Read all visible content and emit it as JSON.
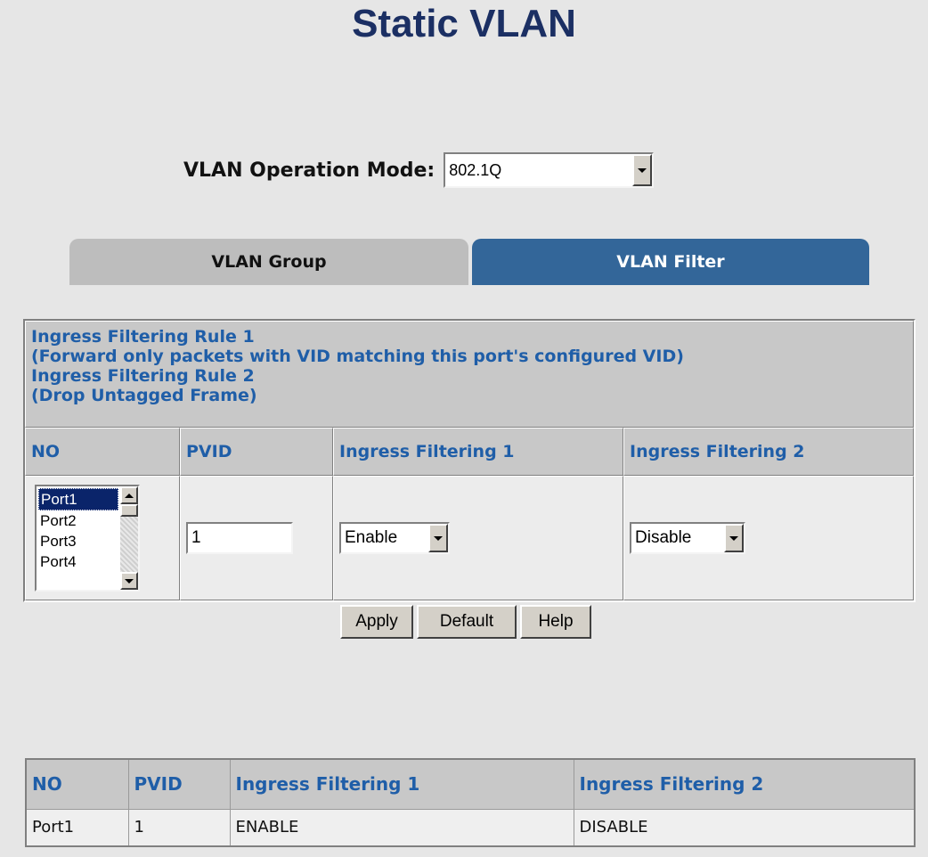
{
  "page": {
    "title": "Static VLAN"
  },
  "mode": {
    "label": "VLAN Operation Mode:",
    "value": "802.1Q"
  },
  "tabs": [
    {
      "label": "VLAN Group",
      "active": false
    },
    {
      "label": "VLAN Filter",
      "active": true
    }
  ],
  "rules": {
    "line1": "Ingress Filtering Rule 1",
    "line2": "(Forward only packets with VID matching this port's configured VID)",
    "line3": "Ingress Filtering Rule 2",
    "line4": "(Drop Untagged Frame)"
  },
  "config_table": {
    "headers": [
      "NO",
      "PVID",
      "Ingress Filtering 1",
      "Ingress Filtering 2"
    ],
    "ports": [
      "Port1",
      "Port2",
      "Port3",
      "Port4"
    ],
    "selected_port": "Port1",
    "pvid_value": "1",
    "ingress1_value": "Enable",
    "ingress2_value": "Disable"
  },
  "buttons": {
    "apply": "Apply",
    "default": "Default",
    "help": "Help"
  },
  "summary_table": {
    "headers": [
      "NO",
      "PVID",
      "Ingress Filtering 1",
      "Ingress Filtering 2"
    ],
    "rows": [
      {
        "no": "Port1",
        "pvid": "1",
        "ingress1": "ENABLE",
        "ingress2": "DISABLE"
      }
    ]
  },
  "colors": {
    "title": "#1b2f63",
    "active_tab": "#336699",
    "header_text": "#1f5ea8"
  }
}
